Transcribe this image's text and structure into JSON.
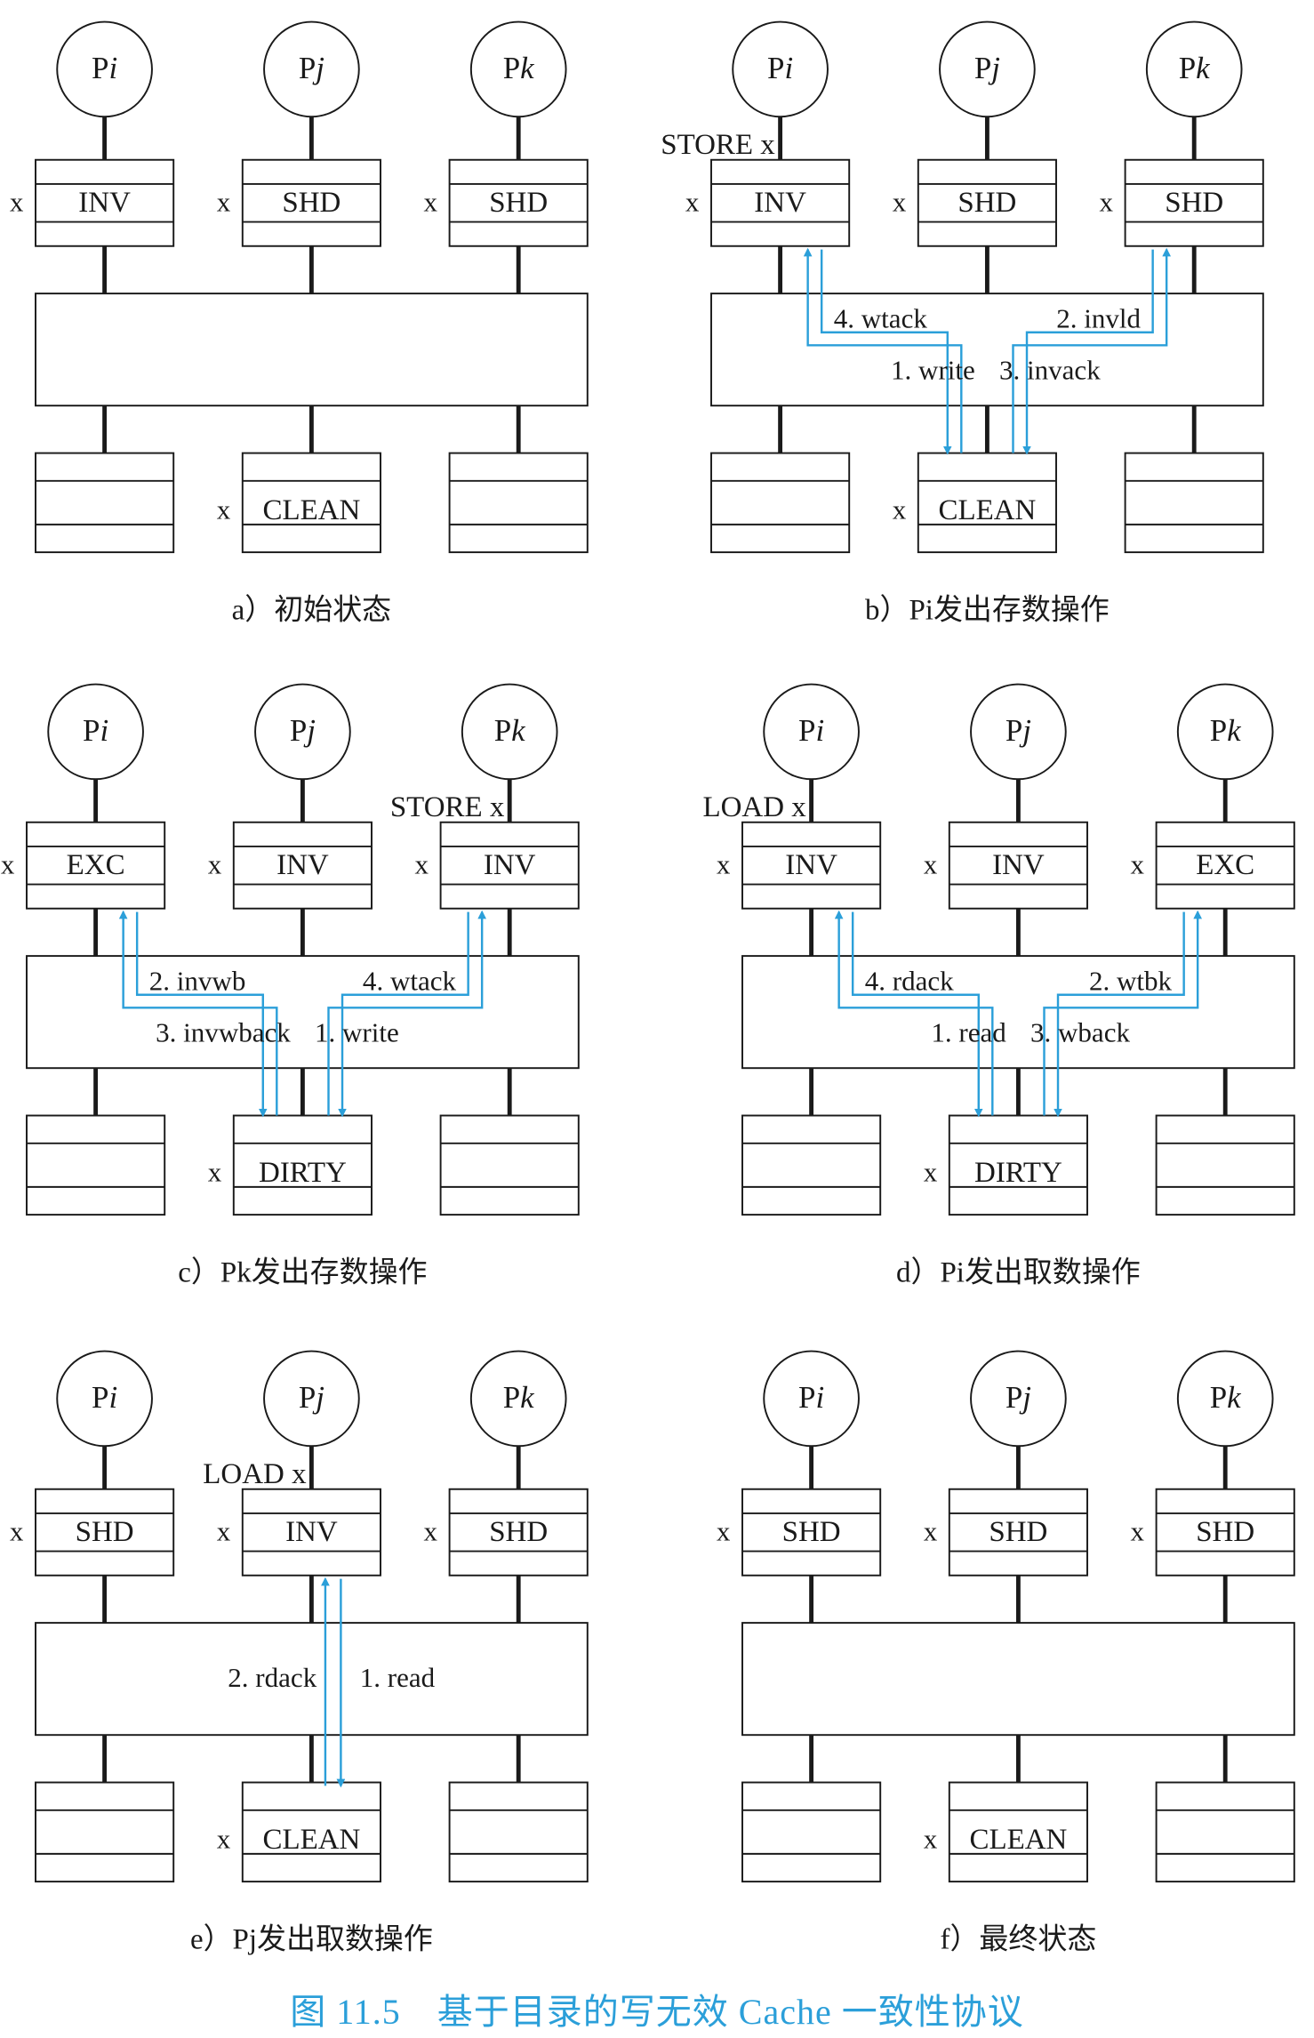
{
  "figure_caption": "图 11.5　基于目录的写无效 Cache 一致性协议",
  "colors": {
    "ink": "#1a1a1a",
    "arrow": "#2b9fd9",
    "caption": "#2b9fd9"
  },
  "panels": [
    {
      "id": "a",
      "caption": "a）初始状态",
      "processors": [
        {
          "base": "P",
          "sub": "i"
        },
        {
          "base": "P",
          "sub": "j"
        },
        {
          "base": "P",
          "sub": "k"
        }
      ],
      "caches": [
        {
          "state": "INV",
          "tag": "x"
        },
        {
          "state": "SHD",
          "tag": "x"
        },
        {
          "state": "SHD",
          "tag": "x"
        }
      ],
      "memory": [
        {
          "state": "",
          "tag": ""
        },
        {
          "state": "CLEAN",
          "tag": "x"
        },
        {
          "state": "",
          "tag": ""
        }
      ],
      "op": null,
      "links": [],
      "messages": []
    },
    {
      "id": "b",
      "caption": "b）Pi发出存数操作",
      "processors": [
        {
          "base": "P",
          "sub": "i"
        },
        {
          "base": "P",
          "sub": "j"
        },
        {
          "base": "P",
          "sub": "k"
        }
      ],
      "caches": [
        {
          "state": "INV",
          "tag": "x"
        },
        {
          "state": "SHD",
          "tag": "x"
        },
        {
          "state": "SHD",
          "tag": "x"
        }
      ],
      "memory": [
        {
          "state": "",
          "tag": ""
        },
        {
          "state": "CLEAN",
          "tag": "x"
        },
        {
          "state": "",
          "tag": ""
        }
      ],
      "op": {
        "proc": 0,
        "text": "STORE x"
      },
      "links": [
        {
          "from": 0,
          "to": 1,
          "lanes": 2,
          "lane_mode": "right",
          "y_off": 0
        },
        {
          "from": 2,
          "to": 1,
          "lanes": 2,
          "lane_mode": "left",
          "y_off": 0
        }
      ],
      "messages": [
        {
          "text": "4. wtack",
          "proc": 0,
          "row": "top",
          "side": "right"
        },
        {
          "text": "1. write",
          "proc": 0,
          "row": "bottom",
          "side": "right"
        },
        {
          "text": "2. invld",
          "proc": 2,
          "row": "top",
          "side": "left"
        },
        {
          "text": "3. invack",
          "proc": 2,
          "row": "bottom",
          "side": "left"
        }
      ]
    },
    {
      "id": "c",
      "caption": "c）Pk发出存数操作",
      "processors": [
        {
          "base": "P",
          "sub": "i"
        },
        {
          "base": "P",
          "sub": "j"
        },
        {
          "base": "P",
          "sub": "k"
        }
      ],
      "caches": [
        {
          "state": "EXC",
          "tag": "x"
        },
        {
          "state": "INV",
          "tag": "x"
        },
        {
          "state": "INV",
          "tag": "x"
        }
      ],
      "memory": [
        {
          "state": "",
          "tag": ""
        },
        {
          "state": "DIRTY",
          "tag": "x"
        },
        {
          "state": "",
          "tag": ""
        }
      ],
      "op": {
        "proc": 2,
        "text": "STORE x"
      },
      "links": [
        {
          "from": 0,
          "to": 1,
          "lanes": 2,
          "lane_mode": "right",
          "y_off": 0
        },
        {
          "from": 2,
          "to": 1,
          "lanes": 2,
          "lane_mode": "left",
          "y_off": 0
        }
      ],
      "messages": [
        {
          "text": "2. invwb",
          "proc": 0,
          "row": "top",
          "side": "right"
        },
        {
          "text": "3. invwback",
          "proc": 0,
          "row": "bottom",
          "side": "right"
        },
        {
          "text": "4. wtack",
          "proc": 2,
          "row": "top",
          "side": "left"
        },
        {
          "text": "1. write",
          "proc": 2,
          "row": "bottom",
          "side": "left"
        }
      ]
    },
    {
      "id": "d",
      "caption": "d）Pi发出取数操作",
      "processors": [
        {
          "base": "P",
          "sub": "i"
        },
        {
          "base": "P",
          "sub": "j"
        },
        {
          "base": "P",
          "sub": "k"
        }
      ],
      "caches": [
        {
          "state": "INV",
          "tag": "x"
        },
        {
          "state": "INV",
          "tag": "x"
        },
        {
          "state": "EXC",
          "tag": "x"
        }
      ],
      "memory": [
        {
          "state": "",
          "tag": ""
        },
        {
          "state": "DIRTY",
          "tag": "x"
        },
        {
          "state": "",
          "tag": ""
        }
      ],
      "op": {
        "proc": 0,
        "text": "LOAD x"
      },
      "links": [
        {
          "from": 0,
          "to": 1,
          "lanes": 2,
          "lane_mode": "right",
          "y_off": 0
        },
        {
          "from": 2,
          "to": 1,
          "lanes": 2,
          "lane_mode": "left",
          "y_off": 0
        }
      ],
      "messages": [
        {
          "text": "4. rdack",
          "proc": 0,
          "row": "top",
          "side": "right"
        },
        {
          "text": "1. read",
          "proc": 0,
          "row": "bottom",
          "side": "right"
        },
        {
          "text": "2. wtbk",
          "proc": 2,
          "row": "top",
          "side": "left"
        },
        {
          "text": "3. wback",
          "proc": 2,
          "row": "bottom",
          "side": "left"
        }
      ]
    },
    {
      "id": "e",
      "caption": "e）Pj发出取数操作",
      "processors": [
        {
          "base": "P",
          "sub": "i"
        },
        {
          "base": "P",
          "sub": "j"
        },
        {
          "base": "P",
          "sub": "k"
        }
      ],
      "caches": [
        {
          "state": "SHD",
          "tag": "x"
        },
        {
          "state": "INV",
          "tag": "x"
        },
        {
          "state": "SHD",
          "tag": "x"
        }
      ],
      "memory": [
        {
          "state": "",
          "tag": ""
        },
        {
          "state": "CLEAN",
          "tag": "x"
        },
        {
          "state": "",
          "tag": ""
        }
      ],
      "op": {
        "proc": 1,
        "text": "LOAD x"
      },
      "links": [
        {
          "from": 1,
          "to": 1,
          "lanes": 2,
          "lane_mode": "center",
          "y_off": 0
        }
      ],
      "messages": [
        {
          "text": "2. rdack",
          "proc": 1,
          "row": "mid",
          "side": "left"
        },
        {
          "text": "1. read",
          "proc": 1,
          "row": "mid",
          "side": "right"
        }
      ]
    },
    {
      "id": "f",
      "caption": "f）最终状态",
      "processors": [
        {
          "base": "P",
          "sub": "i"
        },
        {
          "base": "P",
          "sub": "j"
        },
        {
          "base": "P",
          "sub": "k"
        }
      ],
      "caches": [
        {
          "state": "SHD",
          "tag": "x"
        },
        {
          "state": "SHD",
          "tag": "x"
        },
        {
          "state": "SHD",
          "tag": "x"
        }
      ],
      "memory": [
        {
          "state": "",
          "tag": ""
        },
        {
          "state": "CLEAN",
          "tag": "x"
        },
        {
          "state": "",
          "tag": ""
        }
      ],
      "op": null,
      "links": [],
      "messages": []
    }
  ]
}
